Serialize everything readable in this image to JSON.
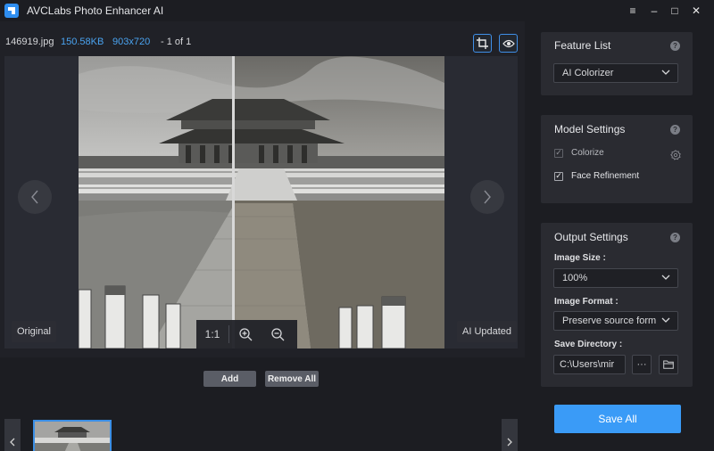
{
  "window": {
    "title": "AVCLabs Photo Enhancer AI",
    "controls": {
      "menu": "≡",
      "minimize": "–",
      "maximize": "□",
      "close": "✕"
    }
  },
  "file_info": {
    "name": "146919.jpg",
    "size": "150.58KB",
    "dimensions": "903x720",
    "counter": "- 1 of 1"
  },
  "viewer": {
    "left_label": "Original",
    "right_label": "AI Updated",
    "zoom_reset": "1:1",
    "split_position": 0.42
  },
  "queue": {
    "add_label": "Add",
    "remove_all_label": "Remove All"
  },
  "feature_list": {
    "title": "Feature List",
    "selected": "AI Colorizer"
  },
  "model_settings": {
    "title": "Model Settings",
    "options": [
      {
        "label": "Colorize",
        "checked": true,
        "disabled": true
      },
      {
        "label": "Face Refinement",
        "checked": true,
        "disabled": false
      }
    ]
  },
  "output_settings": {
    "title": "Output Settings",
    "image_size_label": "Image Size :",
    "image_size_value": "100%",
    "image_format_label": "Image Format :",
    "image_format_value": "Preserve source format",
    "save_directory_label": "Save Directory :",
    "save_directory_value": "C:\\Users\\mir",
    "more_label": "···"
  },
  "save_all_label": "Save All",
  "colors": {
    "accent": "#3a9bf7",
    "info_blue": "#4aa3f0",
    "panel_bg": "#2a2b31",
    "app_bg": "#1c1d22"
  }
}
